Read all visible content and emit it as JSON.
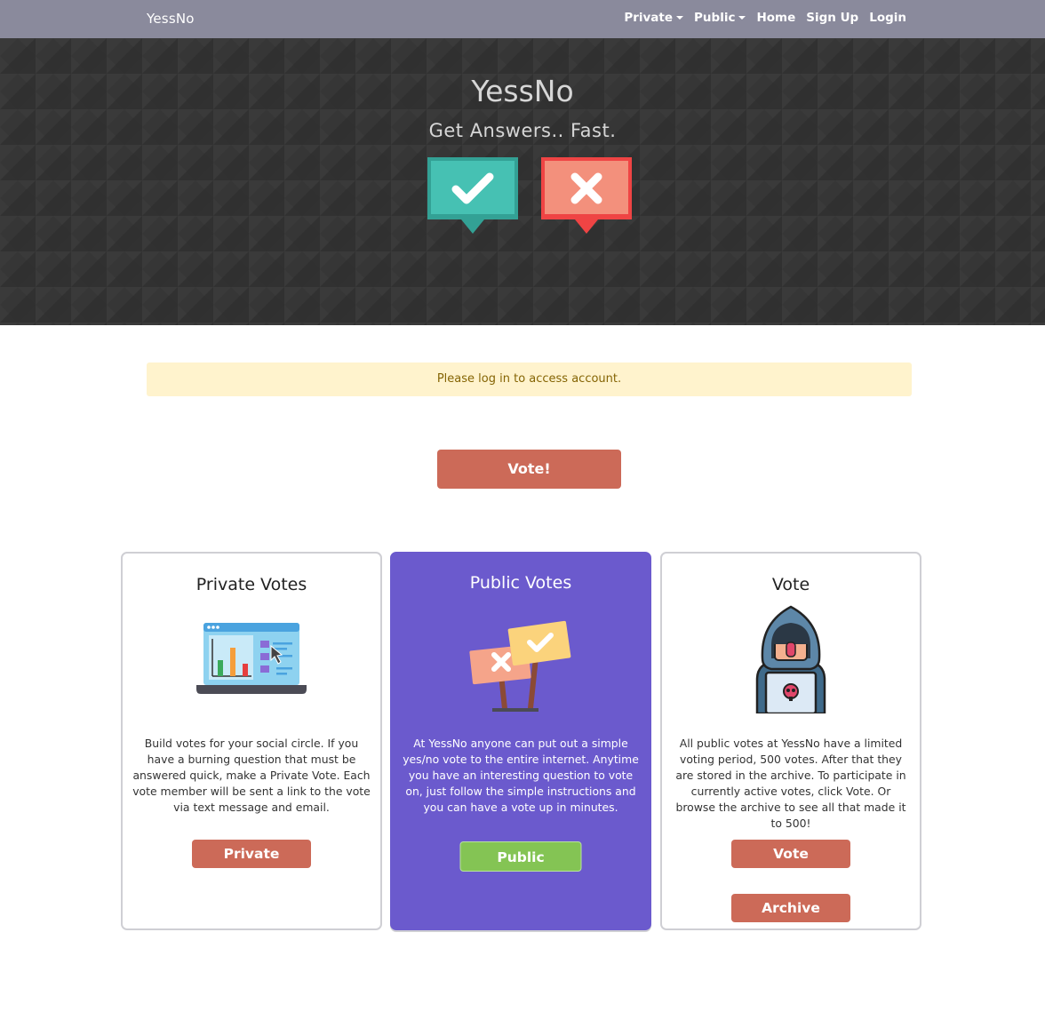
{
  "navbar": {
    "brand": "YessNo",
    "links": [
      {
        "label": "Private",
        "dropdown": true
      },
      {
        "label": "Public",
        "dropdown": true
      },
      {
        "label": "Home",
        "dropdown": false
      },
      {
        "label": "Sign Up",
        "dropdown": false
      },
      {
        "label": "Login",
        "dropdown": false
      }
    ]
  },
  "hero": {
    "title": "YessNo",
    "subtitle": "Get Answers.. Fast.",
    "icons": [
      "check-speech-bubble-icon",
      "x-speech-bubble-icon"
    ]
  },
  "alert": {
    "message": "Please log in to access account."
  },
  "main_button": {
    "label": "Vote!"
  },
  "cards": [
    {
      "title": "Private Votes",
      "icon": "laptop-chart-icon",
      "text": "Build votes for your social circle. If you have a burning question that must be answered quick, make a Private Vote. Each vote member will be sent a link to the vote via text message and email.",
      "buttons": [
        "Private"
      ]
    },
    {
      "title": "Public Votes",
      "icon": "protest-signs-icon",
      "text": "At YessNo anyone can put out a simple yes/no vote to the entire internet. Anytime you have an interesting question to vote on, just follow the simple instructions and you can have a vote up in minutes.",
      "buttons": [
        "Public"
      ]
    },
    {
      "title": "Vote",
      "icon": "hooded-hacker-icon",
      "text": "All public votes at YessNo have a limited voting period, 500 votes. After that they are stored in the archive. To participate in currently active votes, click Vote. Or browse the archive to see all that made it to 500!",
      "buttons": [
        "Vote",
        "Archive"
      ]
    }
  ],
  "colors": {
    "navbar": "#8a8a9c",
    "hero_bg": "#363636",
    "accent_button": "#cc6a58",
    "public_card": "#6b5acd",
    "public_button": "#84c454",
    "alert_bg": "#fff3cd"
  }
}
